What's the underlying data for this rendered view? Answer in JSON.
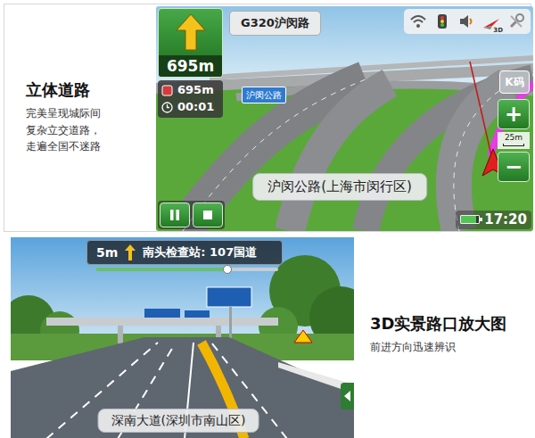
{
  "overpass": {
    "title": "立体道路",
    "description": "完美呈现城际间复杂立交道路，走遍全国不迷路",
    "nav": {
      "turn_distance": "695m",
      "next_road": "G320沪闵路",
      "remaining_distance": "695m",
      "remaining_time": "00:01",
      "compass_label": "3D",
      "k_button": "K码",
      "zoom_in": "+",
      "scale": "25m",
      "zoom_out": "−",
      "map_label": "沪闵公路",
      "current_road": "沪闵公路(上海市闵行区)",
      "battery_level": 0.85,
      "clock": "17:20"
    }
  },
  "junction": {
    "title": "3D实景路口放大图",
    "description": "前进方向迅速辨识",
    "nav": {
      "distance": "5m",
      "next_road": "南头检查站: 107国道",
      "progress_level": 0.72,
      "current_road": "深南大道(深圳市南山区)"
    }
  }
}
